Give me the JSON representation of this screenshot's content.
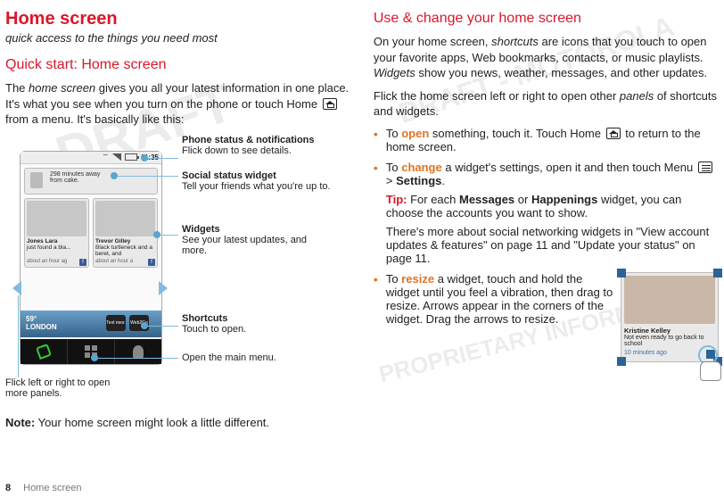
{
  "page": {
    "number": "8",
    "section": "Home screen"
  },
  "left": {
    "h1": "Home screen",
    "sub": "quick access to the things you need most",
    "h2": "Quick start: Home screen",
    "p1a": "The ",
    "p1b": "home screen",
    "p1c": " gives you all your latest information in one place. It's what you see when you turn on the phone or touch Home ",
    "p1d": " from a menu. It's basically like this:",
    "note_lbl": "Note:",
    "note_txt": " Your home screen might look a little different.",
    "phone": {
      "clock": "11:35",
      "social": {
        "line1": "298 minutes away",
        "line2": "from cake."
      },
      "card1": {
        "name": "Jones Lara",
        "line": "just found a bla...",
        "time": "about an hour ag"
      },
      "card2": {
        "name": "Trevor Gilley",
        "line": "Black turtleneck and a beret, and",
        "time": "about an hour a"
      },
      "weather": {
        "temp": "59°",
        "city": "LONDON",
        "s1": "Text mes:",
        "s2": "Web2Go"
      }
    },
    "callouts": {
      "c1t": "Phone status & notifications",
      "c1d": "Flick down to see details.",
      "c2t": "Social status widget",
      "c2d": "Tell your friends what you're up to.",
      "c3t": "Widgets",
      "c3d": "See your latest updates, and more.",
      "c4t": "Shortcuts",
      "c4d": "Touch to open.",
      "c5": "Open the main menu.",
      "c6": "Flick left or right to open more panels."
    }
  },
  "right": {
    "h2": "Use & change your home screen",
    "p1a": "On your home screen, ",
    "p1b": "shortcuts",
    "p1c": " are icons that you touch to open your favorite apps, Web bookmarks, contacts, or music playlists. ",
    "p1d": "Widgets",
    "p1e": " show you news, weather, messages, and other updates.",
    "p2a": "Flick the home screen left or right to open other ",
    "p2b": "panels",
    "p2c": " of shortcuts and widgets.",
    "b1a": "To ",
    "b1b": "open",
    "b1c": " something, touch it. Touch Home ",
    "b1d": " to return to the home screen.",
    "b2a": "To ",
    "b2b": "change",
    "b2c": " a widget's settings, open it and then touch Menu ",
    "b2d": " > ",
    "b2e": "Settings",
    "b2f": ".",
    "tip_lbl": "Tip:",
    "tip_a": " For each ",
    "tip_b": "Messages",
    "tip_c": " or ",
    "tip_d": "Happenings",
    "tip_e": " widget, you can choose the accounts you want to show.",
    "p3": "There's more about social networking widgets in \"View account updates & features\" on page 11 and \"Update your status\" on page 11.",
    "b3a": "To ",
    "b3b": "resize",
    "b3c": " a widget, touch and hold the widget until you feel a vibration, then drag to resize. Arrows appear in the corners of the widget. Drag the arrows to resize.",
    "mini": {
      "name": "Kristine Kelley",
      "line": "Not even ready to go back to school",
      "time": "10 minutes ago"
    }
  },
  "watermarks": {
    "w1": "DRAFT",
    "w2": "DRAFT - MOTOROLA",
    "w3": "PROPRIETARY INFORMATION"
  }
}
